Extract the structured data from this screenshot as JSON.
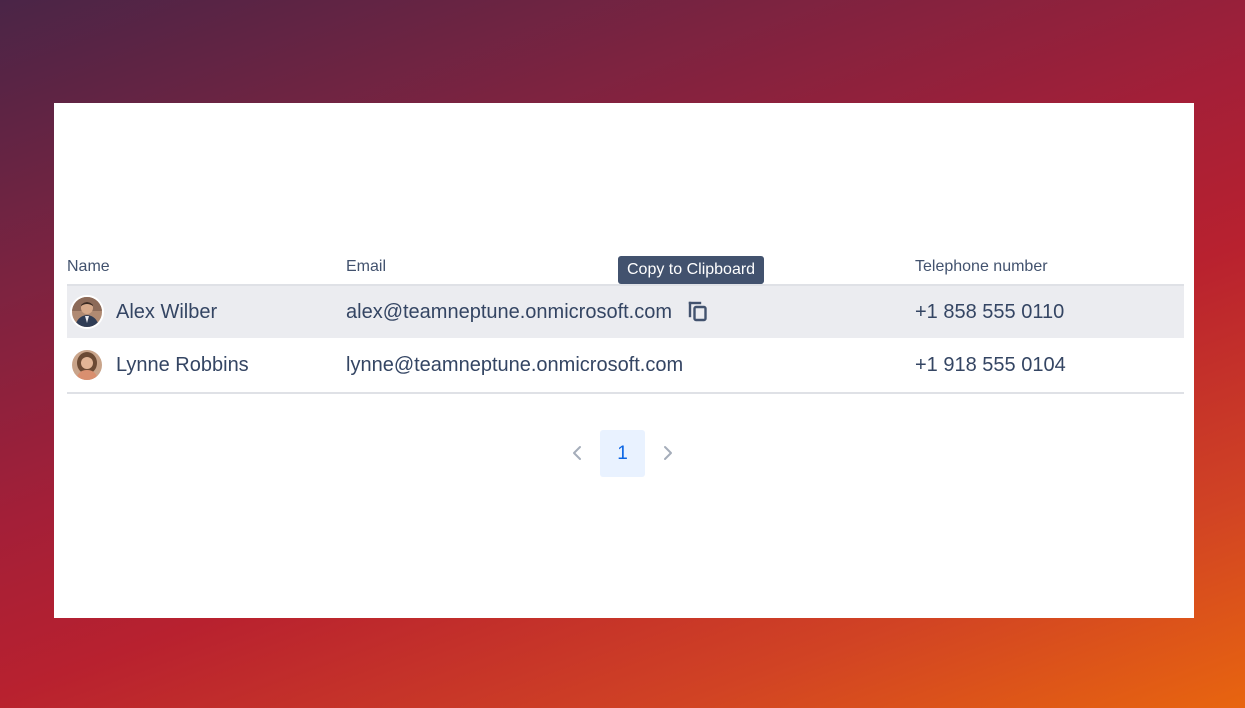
{
  "table": {
    "headers": {
      "name": "Name",
      "email": "Email",
      "phone": "Telephone number"
    },
    "rows": [
      {
        "name": "Alex Wilber",
        "email": "alex@teamneptune.onmicrosoft.com",
        "phone": "+1 858 555 0110",
        "avatar_icon": "avatar-man-photo"
      },
      {
        "name": "Lynne Robbins",
        "email": "lynne@teamneptune.onmicrosoft.com",
        "phone": "+1 918 555 0104",
        "avatar_icon": "avatar-woman-photo"
      }
    ]
  },
  "tooltip": {
    "text": "Copy to Clipboard"
  },
  "pagination": {
    "current_page": "1",
    "prev_icon": "chevron-left-icon",
    "next_icon": "chevron-right-icon"
  },
  "colors": {
    "header_text": "#42526e",
    "cell_text": "#344563",
    "row_hover": "#ebecf0",
    "page_active_bg": "#e9f2ff",
    "page_active_text": "#0c66e4",
    "tooltip_bg": "#42526e"
  }
}
